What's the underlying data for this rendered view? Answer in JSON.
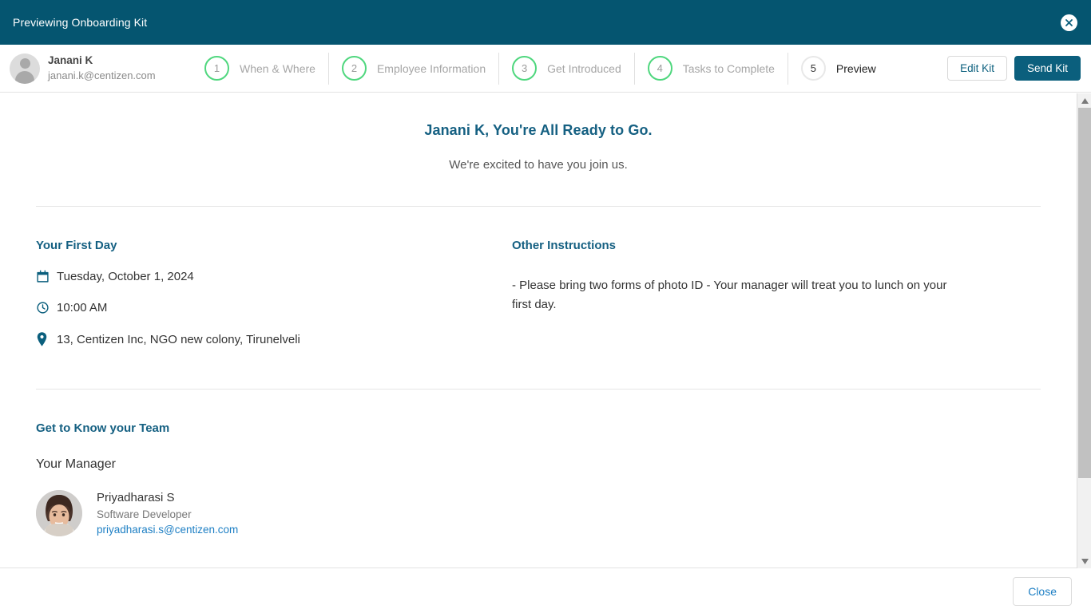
{
  "topbar": {
    "title": "Previewing Onboarding Kit",
    "close_icon": "close-circle-icon"
  },
  "user": {
    "name": "Janani K",
    "email": "janani.k@centizen.com",
    "avatar_icon": "user-placeholder-avatar"
  },
  "stepper": {
    "steps": [
      {
        "number": "1",
        "label": "When & Where",
        "state": "done"
      },
      {
        "number": "2",
        "label": "Employee Information",
        "state": "done"
      },
      {
        "number": "3",
        "label": "Get Introduced",
        "state": "done"
      },
      {
        "number": "4",
        "label": "Tasks to Complete",
        "state": "done"
      },
      {
        "number": "5",
        "label": "Preview",
        "state": "current"
      }
    ]
  },
  "actions": {
    "edit_label": "Edit Kit",
    "send_label": "Send Kit"
  },
  "hero": {
    "title": "Janani K, You're All Ready to Go.",
    "subtitle": "We're excited to have you join us."
  },
  "first_day": {
    "heading": "Your First Day",
    "date": "Tuesday, October 1, 2024",
    "time": "10:00 AM",
    "location": "13, Centizen Inc, NGO new colony, Tirunelveli",
    "date_icon": "calendar-icon",
    "time_icon": "clock-icon",
    "location_icon": "map-pin-icon"
  },
  "other_instructions": {
    "heading": "Other Instructions",
    "body": "- Please bring two forms of photo ID - Your manager will treat you to lunch on your first day."
  },
  "team": {
    "heading": "Get to Know your Team",
    "subheading": "Your Manager",
    "manager": {
      "name": "Priyadharasi S",
      "role": "Software Developer",
      "email": "priyadharasi.s@centizen.com"
    }
  },
  "scrollbar": {
    "up_icon": "scroll-up-arrow-icon",
    "down_icon": "scroll-down-arrow-icon"
  },
  "footer": {
    "close_label": "Close"
  },
  "colors": {
    "header_teal": "#055570",
    "brand_teal": "#0b5f7d",
    "heading_blue": "#156082",
    "step_green": "#4fd77e",
    "link_blue": "#1d7fc4"
  }
}
